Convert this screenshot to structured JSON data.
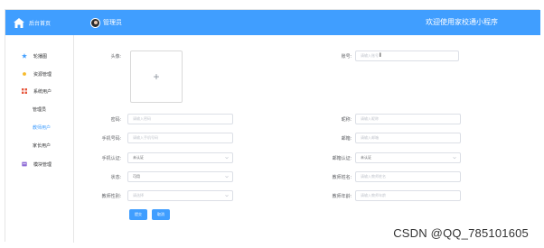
{
  "header": {
    "brand": "后台首页",
    "user_name": "管理员",
    "welcome": "欢迎使用家校通小程序"
  },
  "sidebar": {
    "items": [
      {
        "label": "轮播图",
        "icon": "star-icon"
      },
      {
        "label": "资源管理",
        "icon": "sun-icon"
      },
      {
        "label": "系统用户",
        "icon": "grid-icon"
      },
      {
        "label": "管理员"
      },
      {
        "label": "教师用户",
        "active": true
      },
      {
        "label": "家长用户"
      },
      {
        "label": "模块管理",
        "icon": "box-icon"
      }
    ]
  },
  "form": {
    "avatar_label": "头像:",
    "account_label": "账号:",
    "account_placeholder": "请输入账号",
    "password_label": "密码:",
    "password_placeholder": "请输入密码",
    "nickname_label": "昵称:",
    "nickname_placeholder": "请输入昵称",
    "phone_label": "手机号码:",
    "phone_placeholder": "请输入手机号码",
    "email_label": "邮箱:",
    "email_placeholder": "请输入邮箱",
    "phone_verify_label": "手机认证:",
    "phone_verify_value": "未认证",
    "email_verify_label": "邮箱认证:",
    "email_verify_value": "未认证",
    "status_label": "状态:",
    "status_value": "可用",
    "teacher_name_label": "教师姓名:",
    "teacher_name_placeholder": "请输入教师姓名",
    "teacher_gender_label": "教师性别:",
    "teacher_gender_placeholder": "请选择",
    "teacher_age_label": "教师年龄:",
    "teacher_age_placeholder": "请输入教师年龄",
    "submit_label": "提交",
    "cancel_label": "取消"
  },
  "watermark": "CSDN @QQ_785101605",
  "colors": {
    "accent": "#409eff",
    "border": "#dcdfe6",
    "placeholder": "#c0c4cc"
  }
}
